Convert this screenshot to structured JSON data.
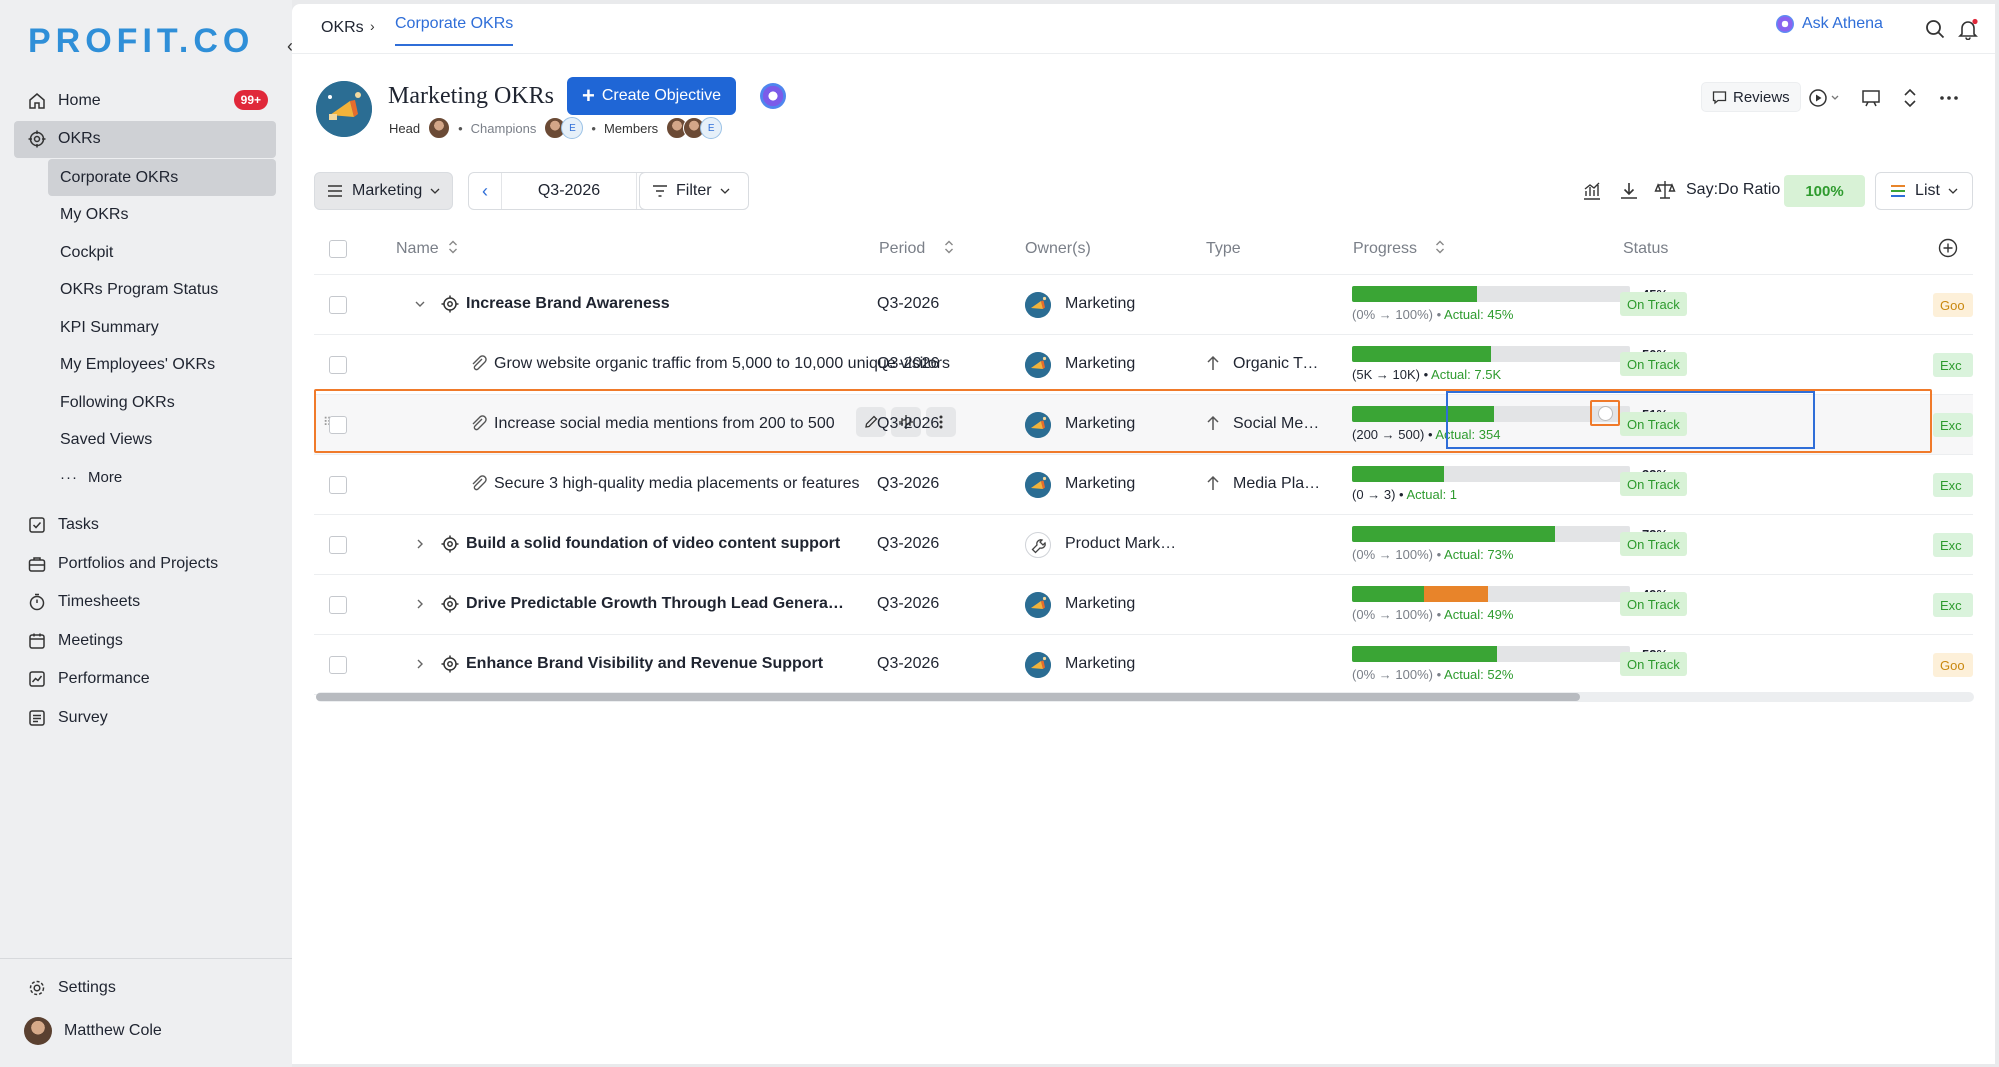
{
  "app": {
    "logo": "PROFIT.CO"
  },
  "sidebar": {
    "items": [
      {
        "label": "Home",
        "badge": "99+"
      },
      {
        "label": "OKRs"
      },
      {
        "label": "Tasks"
      },
      {
        "label": "Portfolios and Projects"
      },
      {
        "label": "Timesheets"
      },
      {
        "label": "Meetings"
      },
      {
        "label": "Performance"
      },
      {
        "label": "Survey"
      }
    ],
    "okr_sub": [
      {
        "label": "Corporate OKRs"
      },
      {
        "label": "My OKRs"
      },
      {
        "label": "Cockpit"
      },
      {
        "label": "OKRs Program Status"
      },
      {
        "label": "KPI Summary"
      },
      {
        "label": "My Employees' OKRs"
      },
      {
        "label": "Following OKRs"
      },
      {
        "label": "Saved Views"
      },
      {
        "label": "More"
      }
    ],
    "settings": "Settings",
    "user": "Matthew Cole"
  },
  "topbar": {
    "crumb1": "OKRs",
    "crumb_sep": "›",
    "crumb2": "Corporate OKRs",
    "athena": "Ask Athena"
  },
  "header": {
    "title": "Marketing OKRs",
    "create_label": "Create Objective",
    "head_label": "Head",
    "champions_label": "Champions",
    "members_label": "Members",
    "avatar_letter": "E",
    "reviews_label": "Reviews"
  },
  "toolbar": {
    "group": "Marketing",
    "period": "Q3-2026",
    "filter": "Filter",
    "say_do_label": "Say:Do Ratio",
    "say_do_value": "100%",
    "view": "List"
  },
  "table": {
    "columns": [
      "Name",
      "Period",
      "Owner(s)",
      "Type",
      "Progress",
      "Status"
    ],
    "rows": [
      {
        "name": "Increase Brand Awareness",
        "kind": "objective",
        "expand": "down",
        "period": "Q3-2026",
        "owner": "Marketing",
        "type": "",
        "progress": 45,
        "range_from": "0%",
        "range_to": "100%",
        "actual": "Actual: 45%",
        "pct": "45%",
        "status": "On Track",
        "extra": "Goo",
        "extra_kind": "goo"
      },
      {
        "name": "Grow website organic traffic from 5,000 to 10,000 unique visitors",
        "kind": "kr",
        "period": "Q3-2026",
        "owner": "Marketing",
        "type": "Organic Traffic",
        "progress": 50,
        "range_from": "5K",
        "range_to": "10K",
        "actual": "Actual: 7.5K",
        "pct": "50%",
        "status": "On Track",
        "extra": "Exc",
        "extra_kind": "exc"
      },
      {
        "name": "Increase social media mentions from 200 to 500",
        "kind": "kr",
        "period": "Q3-2026",
        "owner": "Marketing",
        "type": "Social Media",
        "progress": 51,
        "range_from": "200",
        "range_to": "500",
        "actual": "Actual: 354",
        "pct": "51%",
        "status": "On Track",
        "extra": "Exc",
        "extra_kind": "exc"
      },
      {
        "name": "Secure 3 high-quality media placements or features",
        "kind": "kr",
        "period": "Q3-2026",
        "owner": "Marketing",
        "type": "Media Placements",
        "progress": 33,
        "range_from": "0",
        "range_to": "3",
        "actual": "Actual: 1",
        "pct": "33%",
        "status": "On Track",
        "extra": "Exc",
        "extra_kind": "exc"
      },
      {
        "name": "Build a solid foundation of video content support",
        "kind": "objective",
        "expand": "right",
        "period": "Q3-2026",
        "owner": "Product Marketing",
        "type": "",
        "progress": 73,
        "range_from": "0%",
        "range_to": "100%",
        "actual": "Actual: 73%",
        "pct": "73%",
        "status": "On Track",
        "extra": "Exc",
        "extra_kind": "exc"
      },
      {
        "name": "Drive Predictable Growth Through Lead Generation",
        "kind": "objective",
        "expand": "right",
        "period": "Q3-2026",
        "owner": "Marketing",
        "type": "",
        "progress": 26,
        "progress2": 23,
        "range_from": "0%",
        "range_to": "100%",
        "actual": "Actual: 49%",
        "pct": "49%",
        "status": "On Track",
        "extra": "Exc",
        "extra_kind": "exc"
      },
      {
        "name": "Enhance Brand Visibility and Revenue Support",
        "kind": "objective",
        "expand": "right",
        "period": "Q3-2026",
        "owner": "Marketing",
        "type": "",
        "progress": 52,
        "range_from": "0%",
        "range_to": "100%",
        "actual": "Actual: 52%",
        "pct": "52%",
        "status": "On Track",
        "extra": "Goo",
        "extra_kind": "goo"
      }
    ]
  }
}
